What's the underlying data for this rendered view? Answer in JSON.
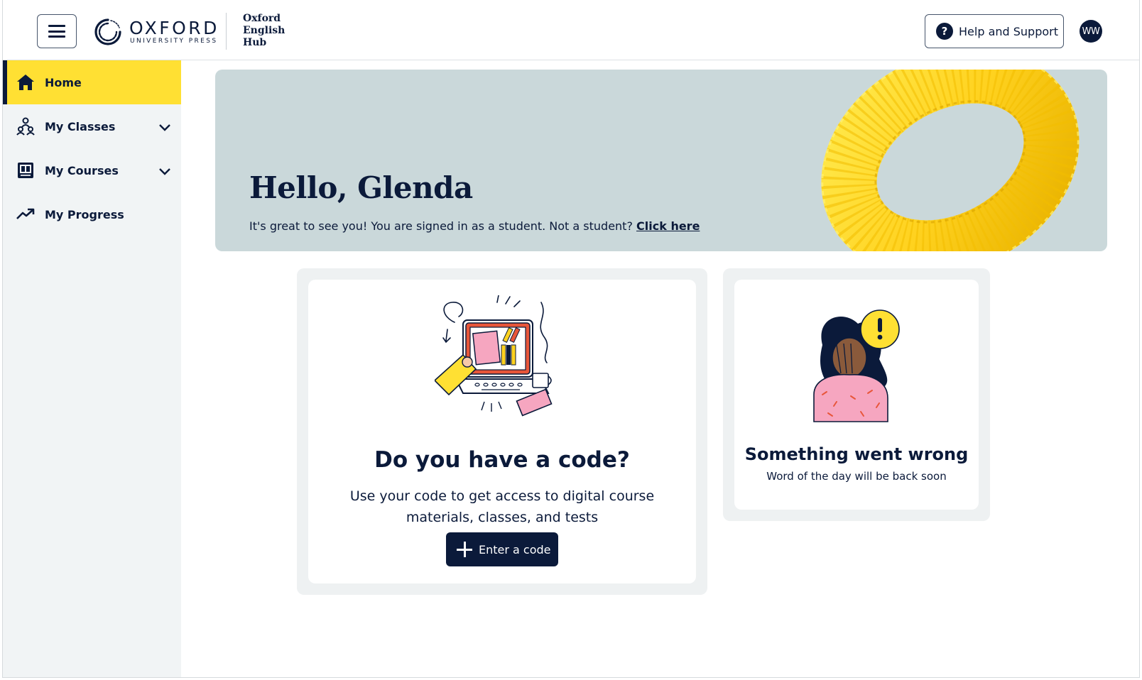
{
  "header": {
    "menu_icon": "hamburger-menu-icon",
    "logo_word": "OXFORD",
    "logo_sub": "UNIVERSITY PRESS",
    "hub_line1": "Oxford",
    "hub_line2": "English",
    "hub_line3": "Hub",
    "help_icon": "question-mark-icon",
    "help_label": "Help and Support",
    "avatar_initials": "WW"
  },
  "sidebar": {
    "items": [
      {
        "label": "Home",
        "icon": "home-icon",
        "active": true
      },
      {
        "label": "My Classes",
        "icon": "classes-icon",
        "expandable": true
      },
      {
        "label": "My Courses",
        "icon": "courses-icon",
        "expandable": true
      },
      {
        "label": "My Progress",
        "icon": "trending-up-icon"
      }
    ]
  },
  "banner": {
    "title": "Hello, Glenda",
    "subtitle": "It's great to see you! You are signed in as a student. Not a student?",
    "link": "Click here"
  },
  "code_card": {
    "title": "Do you have a code?",
    "description": "Use your code to get access to digital course materials, classes, and tests",
    "button_label": "Enter a code"
  },
  "word_of_day": {
    "title": "Something went wrong",
    "message": "Word of the day will be back soon"
  },
  "colors": {
    "navy": "#0b1a3a",
    "accent_yellow": "#ffe033",
    "banner_bg": "#cad8da",
    "sidebar_bg": "#f1f4f5"
  }
}
